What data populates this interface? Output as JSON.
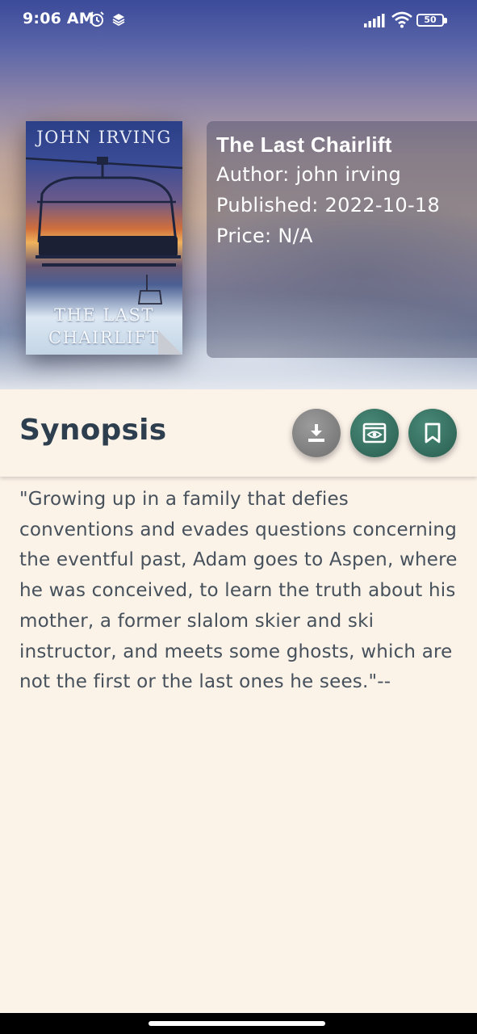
{
  "status_bar": {
    "time": "9:06 AM",
    "battery": "50",
    "icons": [
      "alarm-icon",
      "layers-icon",
      "signal-icon",
      "wifi-icon",
      "battery-icon"
    ]
  },
  "book": {
    "cover_author": "JOHN IRVING",
    "cover_title": "THE LAST\nCHAIRLIFT",
    "title": "The Last Chairlift",
    "author_line": "Author: john irving",
    "published_line": "Published: 2022-10-18",
    "price_line": "Price: N/A"
  },
  "synopsis": {
    "heading": "Synopsis",
    "text": "\"Growing up in a family that defies conventions and evades questions concerning the eventful past, Adam goes to Aspen, where he was conceived, to learn the truth about his mother, a former slalom skier and ski instructor, and meets some ghosts, which are not the first or the last ones he sees.\"--"
  },
  "actions": {
    "download_icon": "download-icon",
    "preview_icon": "preview-eye-icon",
    "bookmark_icon": "bookmark-icon"
  },
  "colors": {
    "background": "#fbf2e8",
    "heading": "#2d3e4e",
    "body_text": "#46515c",
    "fab_green": "#3a7666",
    "fab_gray": "#8a8a8a"
  }
}
